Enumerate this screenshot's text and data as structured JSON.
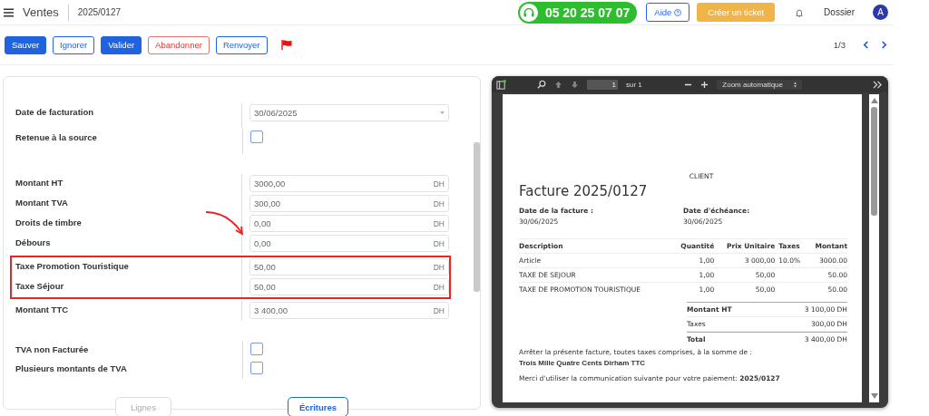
{
  "header": {
    "app": "Ventes",
    "record": "2025/0127",
    "phone": "05 20 25 07 07",
    "help": "Aide",
    "ticket": "Créer un ticket",
    "folder": "Dossier",
    "avatar": "A"
  },
  "toolbar": {
    "buttons": [
      {
        "label": "Sauver",
        "kind": "primary"
      },
      {
        "label": "Ignorer",
        "kind": "outline"
      },
      {
        "label": "Valider",
        "kind": "primary"
      },
      {
        "label": "Abandonner",
        "kind": "danger"
      },
      {
        "label": "Renvoyer",
        "kind": "outline"
      }
    ],
    "pager": "1/3"
  },
  "form": {
    "sections": [
      {
        "rows": [
          {
            "label": "Date de facturation",
            "kind": "date",
            "value": "30/06/2025",
            "highlighted": false
          },
          {
            "label": "Retenue à la source",
            "kind": "checkbox",
            "checked": false,
            "highlighted": false
          }
        ]
      },
      {
        "rows": [
          {
            "label": "Montant HT",
            "kind": "amount",
            "value": "3000,00",
            "unit": "DH",
            "highlighted": false
          },
          {
            "label": "Montant TVA",
            "kind": "amount",
            "value": "300,00",
            "unit": "DH",
            "highlighted": false
          },
          {
            "label": "Droits de timbre",
            "kind": "amount",
            "value": "0,00",
            "unit": "DH",
            "highlighted": false
          },
          {
            "label": "Débours",
            "kind": "amount",
            "value": "0,00",
            "unit": "DH",
            "highlighted": false
          },
          {
            "label": "Taxe Promotion Touristique",
            "kind": "amount",
            "value": "50,00",
            "unit": "DH",
            "highlighted": true
          },
          {
            "label": "Taxe Séjour",
            "kind": "amount",
            "value": "50,00",
            "unit": "DH",
            "highlighted": true
          },
          {
            "label": "Montant TTC",
            "kind": "amount",
            "value": "3 400,00",
            "unit": "DH",
            "highlighted": false
          }
        ]
      },
      {
        "rows": [
          {
            "label": "TVA non Facturée",
            "kind": "checkbox",
            "checked": false,
            "highlighted": false
          },
          {
            "label": "Plusieurs montants de TVA",
            "kind": "checkbox",
            "checked": false,
            "highlighted": false
          }
        ]
      }
    ],
    "buttons": [
      {
        "label": "Lignes",
        "disabled": true
      },
      {
        "label": "Écritures",
        "disabled": false
      }
    ]
  },
  "viewer": {
    "page": "1",
    "pages": "sur 1",
    "zoom": "Zoom automatique",
    "invoice": {
      "client": "CLIENT",
      "title": "Facture 2025/0127",
      "dates": [
        {
          "label": "Date de la facture :",
          "value": "30/06/2025"
        },
        {
          "label": "Date d'échéance:",
          "value": "30/06/2025"
        }
      ],
      "columns": [
        "Description",
        "Quantité",
        "Prix Unitaire",
        "Taxes",
        "Montant"
      ],
      "rows": [
        [
          "Article",
          "1,00",
          "3 000,00",
          "10.0%",
          "3000.00"
        ],
        [
          "TAXE DE SEJOUR",
          "1,00",
          "50,00",
          "",
          "50.00"
        ],
        [
          "TAXE DE PROMOTION TOURISTIQUE",
          "1,00",
          "50,00",
          "",
          "50.00"
        ]
      ],
      "totals": [
        {
          "label": "Montant HT",
          "value": "3 100,00 DH",
          "bold": true
        },
        {
          "label": "Taxes",
          "value": "300,00 DH",
          "bold": false
        },
        {
          "label": "Total",
          "value": "3 400,00 DH",
          "bold": true
        }
      ],
      "sum_intro": "Arrêter la présente facture, toutes taxes comprises, à la somme de :",
      "sum_words": "Trois Mille Quatre Cents Dirham TTC",
      "payment": "Merci d'utiliser la communication suivante pour votre paiement: **2025/0127**"
    }
  }
}
